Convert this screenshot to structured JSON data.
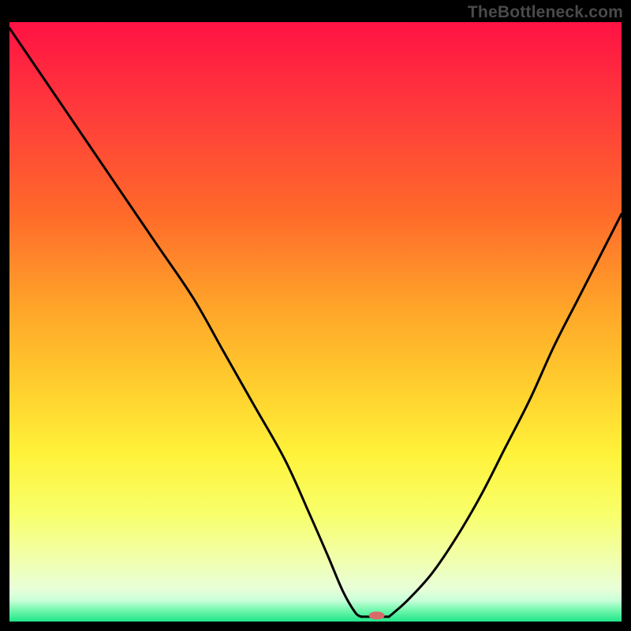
{
  "watermark": "TheBottleneck.com",
  "chart_data": {
    "type": "line",
    "title": "",
    "xlabel": "",
    "ylabel": "",
    "xlim": [
      0,
      100
    ],
    "ylim": [
      0,
      100
    ],
    "grid": false,
    "gradient_stops": [
      {
        "t": 0.0,
        "color": "#ff1244"
      },
      {
        "t": 0.15,
        "color": "#ff3b3b"
      },
      {
        "t": 0.32,
        "color": "#ff6a2a"
      },
      {
        "t": 0.48,
        "color": "#ffa629"
      },
      {
        "t": 0.62,
        "color": "#ffd22e"
      },
      {
        "t": 0.72,
        "color": "#fff23a"
      },
      {
        "t": 0.82,
        "color": "#f8ff6a"
      },
      {
        "t": 0.9,
        "color": "#f0ffb0"
      },
      {
        "t": 0.945,
        "color": "#e8ffd8"
      },
      {
        "t": 0.965,
        "color": "#c8ffd8"
      },
      {
        "t": 0.98,
        "color": "#78f8b0"
      },
      {
        "t": 1.0,
        "color": "#1fe58a"
      }
    ],
    "series": [
      {
        "name": "bottleneck-curve-left",
        "x": [
          0,
          6,
          12,
          18,
          24,
          30,
          35,
          40,
          45,
          49,
          52,
          54.5,
          56.5,
          57.5
        ],
        "y": [
          99,
          90,
          81,
          72,
          63,
          54,
          45,
          36,
          27,
          18,
          11,
          5,
          1.5,
          0.8
        ]
      },
      {
        "name": "bottleneck-curve-right",
        "x": [
          62,
          65,
          69,
          73,
          77,
          81,
          85,
          89,
          93,
          97,
          100
        ],
        "y": [
          0.8,
          3.5,
          8,
          14,
          21,
          29,
          37,
          46,
          54,
          62,
          68
        ]
      }
    ],
    "marker": {
      "x": 60,
      "y": 1.0,
      "color": "#da6a6a",
      "rx": 10,
      "ry": 5
    },
    "flat_bottom": {
      "x_start": 57.5,
      "x_end": 62,
      "y": 0.8
    }
  }
}
